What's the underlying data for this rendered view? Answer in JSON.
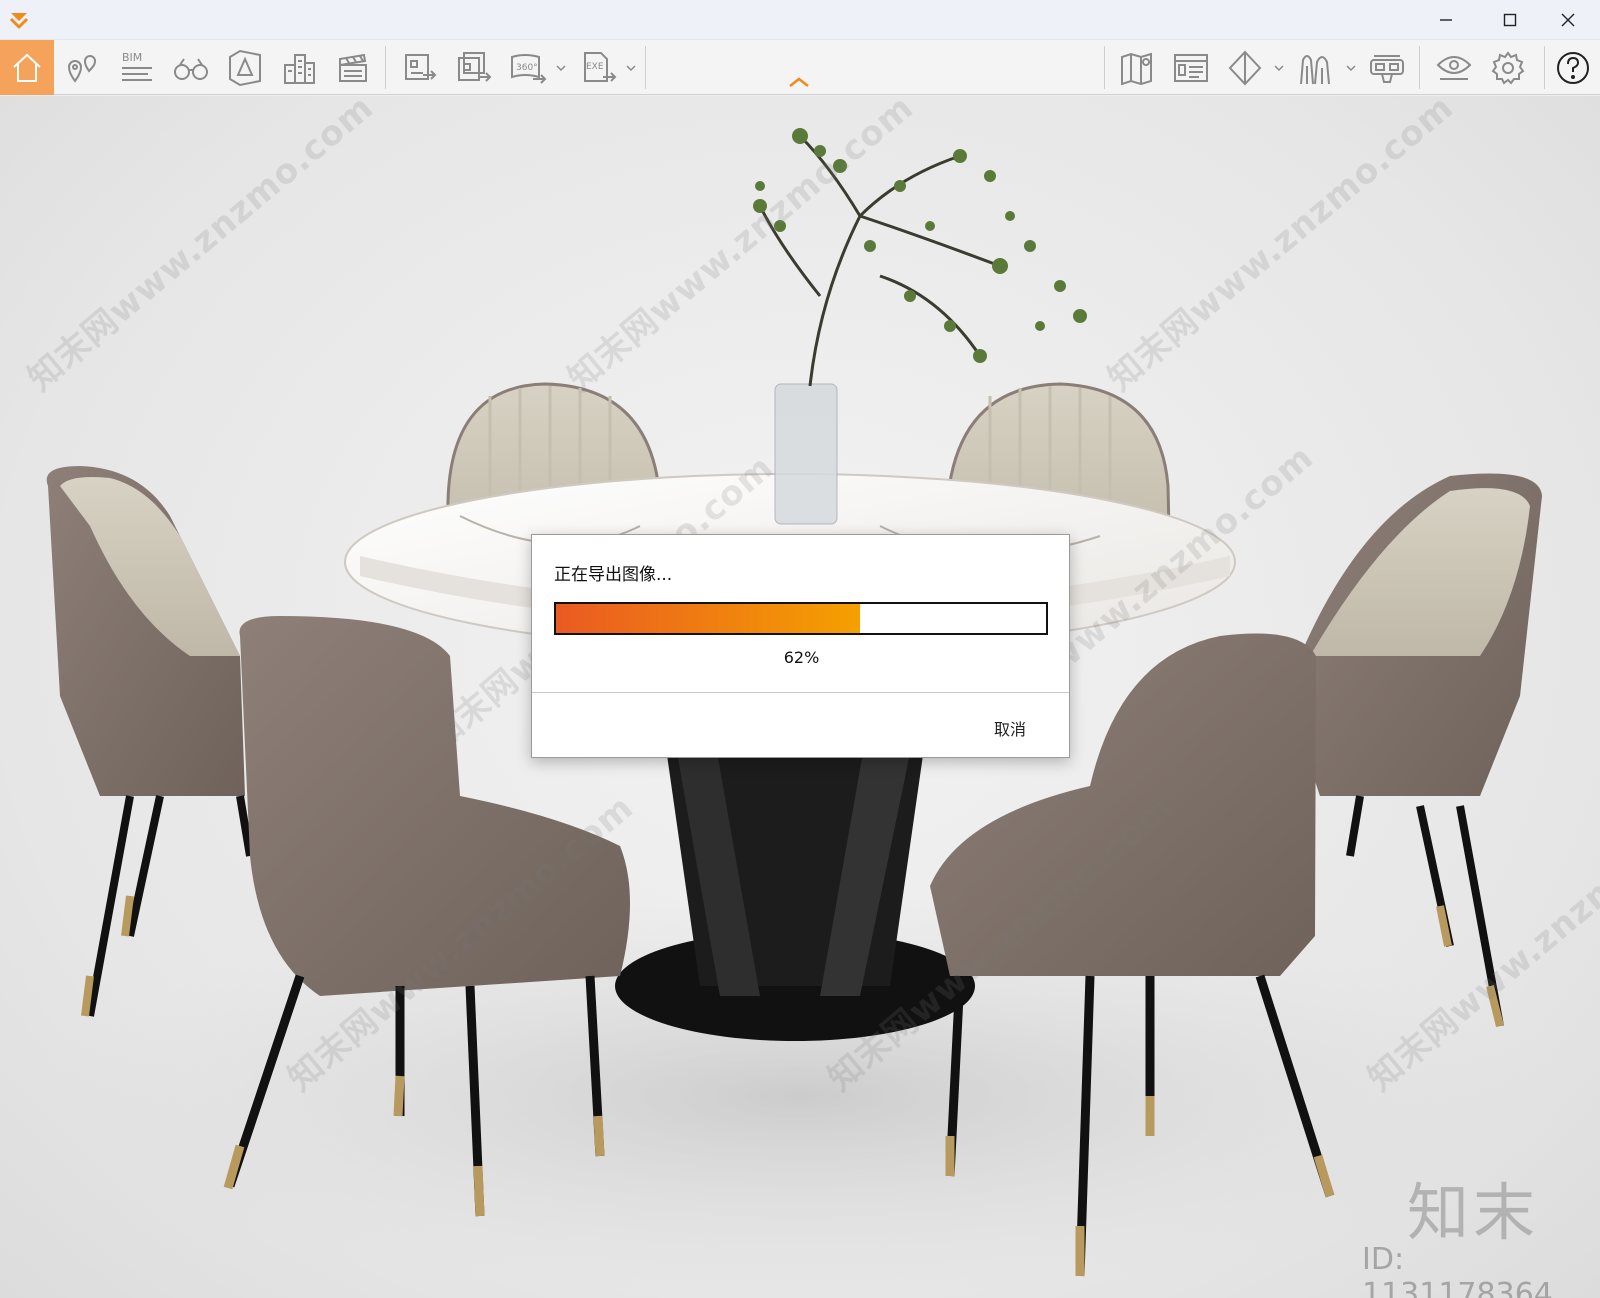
{
  "window": {
    "minimize_icon": "minimize-icon",
    "maximize_icon": "maximize-icon",
    "close_icon": "close-icon"
  },
  "toolbar": {
    "home_active_color": "#f5a35a",
    "bim_label": "BIM",
    "panorama_label": "360°",
    "exe_label": "EXE",
    "icons": [
      "home-icon",
      "location-pins-icon",
      "bim-icon",
      "binoculars-icon",
      "perspective-icon",
      "buildings-icon",
      "clapperboard-icon",
      "export-image-icon",
      "batch-export-icon",
      "export-360-icon",
      "export-exe-icon",
      "map-icon",
      "panel-icon",
      "section-icon",
      "figures-icon",
      "vr-headset-icon",
      "visibility-icon",
      "settings-icon",
      "help-icon"
    ]
  },
  "dialog": {
    "title": "正在导出图像...",
    "progress_fraction": 0.62,
    "progress_text": "62%",
    "cancel_label": "取消",
    "fill_color_start": "#ea5a22",
    "fill_color_end": "#f5a000"
  },
  "watermark": {
    "text": "知末网www.znzmo.com",
    "brand": "知末",
    "id": "ID: 1131178364"
  }
}
